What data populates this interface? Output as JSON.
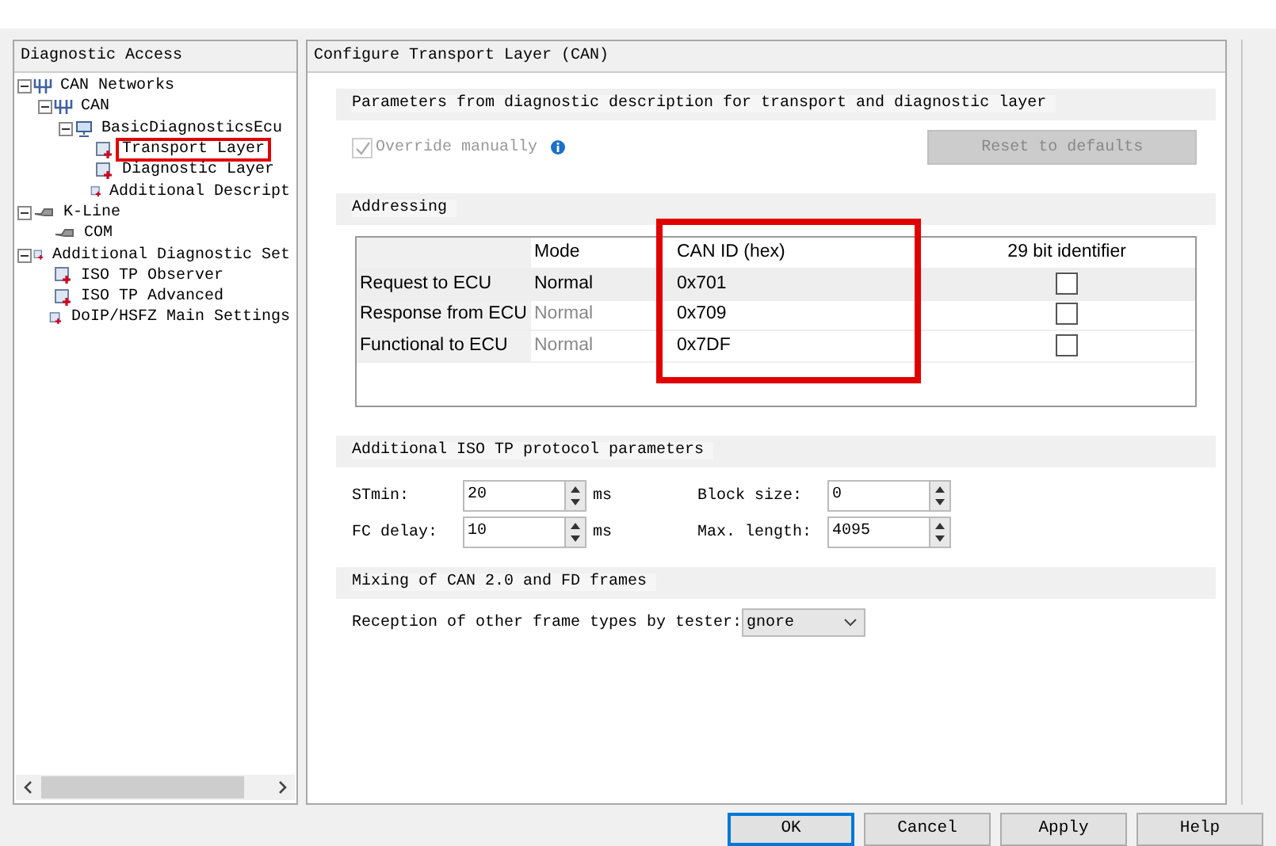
{
  "left_panel": {
    "title": "Diagnostic Access",
    "tree": [
      {
        "label": "CAN Networks",
        "kind": "network",
        "expanded": true,
        "highlighted": false,
        "children": [
          {
            "label": "CAN",
            "kind": "network",
            "expanded": true,
            "highlighted": false,
            "children": [
              {
                "label": "BasicDiagnosticsEcu",
                "kind": "ecu",
                "expanded": true,
                "highlighted": false,
                "children": [
                  {
                    "label": "Transport Layer",
                    "kind": "setting",
                    "highlighted": true
                  },
                  {
                    "label": "Diagnostic Layer",
                    "kind": "setting",
                    "highlighted": false
                  },
                  {
                    "label": "Additional Descript",
                    "kind": "setting",
                    "highlighted": false
                  }
                ]
              }
            ]
          }
        ]
      },
      {
        "label": "K-Line",
        "kind": "cable",
        "expanded": true,
        "highlighted": false,
        "children": [
          {
            "label": "COM",
            "kind": "cable",
            "highlighted": false
          }
        ]
      },
      {
        "label": "Additional Diagnostic Set",
        "kind": "setting",
        "expanded": true,
        "highlighted": false,
        "children": [
          {
            "label": "ISO TP Observer",
            "kind": "setting",
            "highlighted": false
          },
          {
            "label": "ISO TP Advanced",
            "kind": "setting",
            "highlighted": false
          },
          {
            "label": "DoIP/HSFZ Main Settings",
            "kind": "setting",
            "highlighted": false
          }
        ]
      }
    ]
  },
  "right_panel": {
    "title": "Configure Transport Layer (CAN)",
    "parameters": {
      "title": "Parameters from diagnostic description for transport and diagnostic layer",
      "override": {
        "label": "Override manually",
        "checked": true,
        "disabled": true
      },
      "reset_button": {
        "label": "Reset to defaults",
        "disabled": true
      }
    },
    "addressing": {
      "title": "Addressing",
      "columns": [
        {
          "label": "Mode",
          "highlighted": false
        },
        {
          "label": "CAN ID (hex)",
          "highlighted": true
        },
        {
          "label": "29 bit identifier",
          "highlighted": false
        }
      ],
      "rows": [
        {
          "name": "Request to ECU",
          "mode": "Normal",
          "mode_disabled": false,
          "can_id": "0x701",
          "checked": false,
          "selected": true
        },
        {
          "name": "Response from ECU",
          "mode": "Normal",
          "mode_disabled": true,
          "can_id": "0x709",
          "checked": false,
          "selected": false
        },
        {
          "name": "Functional to ECU",
          "mode": "Normal",
          "mode_disabled": true,
          "can_id": "0x7DF",
          "checked": false,
          "selected": false
        }
      ]
    },
    "iso_tp": {
      "title": "Additional ISO TP protocol parameters",
      "fields": [
        {
          "label": "STmin:",
          "value": "20",
          "unit": "ms"
        },
        {
          "label": "Block size:",
          "value": "0"
        },
        {
          "label": "FC delay:",
          "value": "10",
          "unit": "ms"
        },
        {
          "label": "Max. length:",
          "value": "4095"
        }
      ]
    },
    "mixing": {
      "title": "Mixing of CAN 2.0 and FD frames",
      "label": "Reception of other frame types by tester:",
      "value": "gnore"
    }
  },
  "buttons": [
    {
      "label": "OK",
      "default": true
    },
    {
      "label": "Cancel",
      "default": false
    },
    {
      "label": "Apply",
      "default": false
    },
    {
      "label": "Help",
      "default": false
    }
  ]
}
